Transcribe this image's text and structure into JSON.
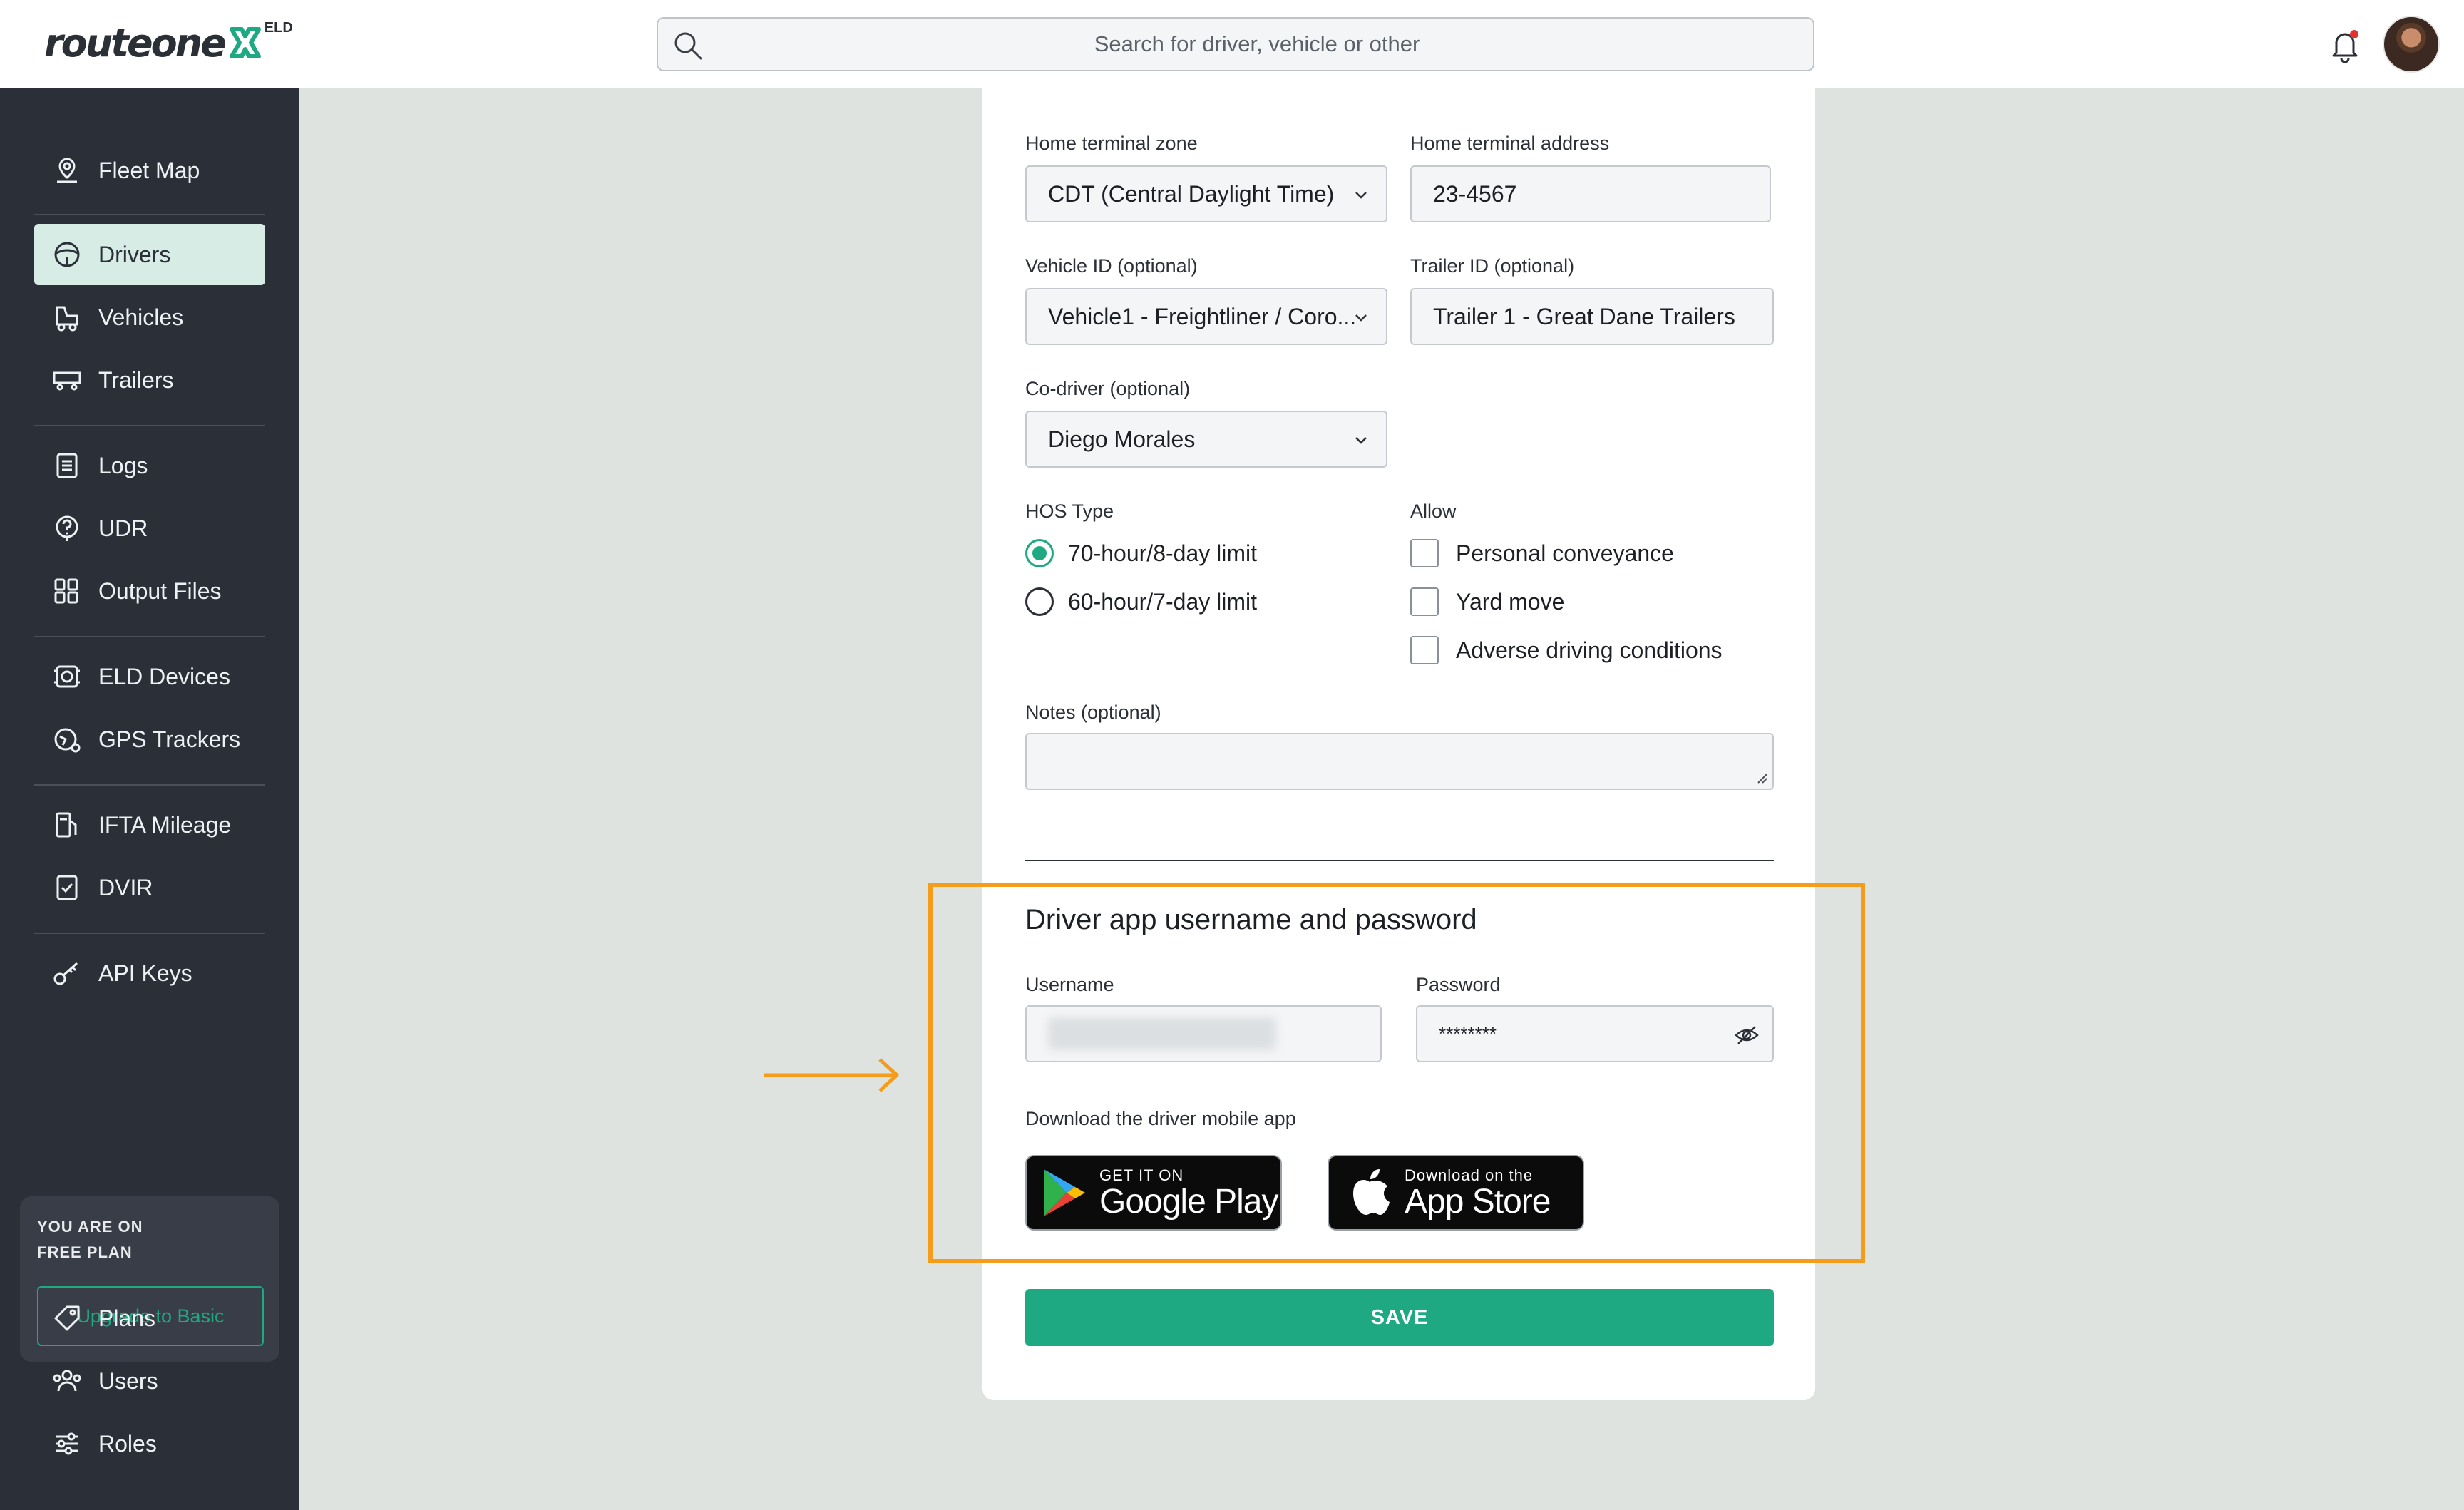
{
  "brand": {
    "name": "routeone",
    "badge": "ELD",
    "accent": "#1fa983",
    "sidebar_bg": "#2b2f38",
    "highlight": "#f59c1a"
  },
  "search": {
    "placeholder": "Search for driver, vehicle or other"
  },
  "sidebar": {
    "items": [
      {
        "label": "Fleet Map",
        "icon": "map-pin-icon"
      },
      {
        "label": "Drivers",
        "icon": "steering-wheel-icon",
        "active": true
      },
      {
        "label": "Vehicles",
        "icon": "truck-icon"
      },
      {
        "label": "Trailers",
        "icon": "trailer-icon"
      },
      {
        "label": "Logs",
        "icon": "clipboard-icon"
      },
      {
        "label": "UDR",
        "icon": "question-circle-icon"
      },
      {
        "label": "Output Files",
        "icon": "grid-icon"
      },
      {
        "label": "ELD Devices",
        "icon": "device-icon"
      },
      {
        "label": "GPS Trackers",
        "icon": "gps-icon"
      },
      {
        "label": "IFTA Mileage",
        "icon": "fuel-icon"
      },
      {
        "label": "DVIR",
        "icon": "checklist-icon"
      },
      {
        "label": "API Keys",
        "icon": "key-icon"
      },
      {
        "label": "Plans",
        "icon": "tag-icon"
      },
      {
        "label": "Users",
        "icon": "users-icon"
      },
      {
        "label": "Roles",
        "icon": "sliders-icon"
      }
    ],
    "plan": {
      "line1": "YOU ARE ON",
      "line2": "FREE PLAN",
      "upgrade_label": "Upgrade to Basic"
    }
  },
  "form": {
    "home_terminal_zone": {
      "label": "Home terminal zone",
      "value": "CDT (Central Daylight Time)"
    },
    "home_terminal_address": {
      "label": "Home terminal address",
      "value": "23-4567"
    },
    "vehicle_id": {
      "label": "Vehicle ID (optional)",
      "value": "Vehicle1 - Freightliner / Coro..."
    },
    "trailer_id": {
      "label": "Trailer ID (optional)",
      "value": "Trailer 1 - Great Dane Trailers"
    },
    "co_driver": {
      "label": "Co-driver (optional)",
      "value": "Diego Morales"
    },
    "hos": {
      "label": "HOS Type",
      "options": [
        "70-hour/8-day limit",
        "60-hour/7-day limit"
      ],
      "selected": "70-hour/8-day limit"
    },
    "allow": {
      "label": "Allow",
      "options": [
        "Personal conveyance",
        "Yard move",
        "Adverse driving conditions"
      ]
    },
    "notes": {
      "label": "Notes (optional)",
      "value": ""
    },
    "credentials": {
      "title": "Driver app username and password",
      "username_label": "Username",
      "password_label": "Password",
      "password_value": "********",
      "download_text": "Download the driver mobile app"
    },
    "google_play": {
      "small": "GET IT ON",
      "big": "Google Play"
    },
    "app_store": {
      "small": "Download on the",
      "big": "App Store"
    },
    "save_label": "SAVE"
  }
}
